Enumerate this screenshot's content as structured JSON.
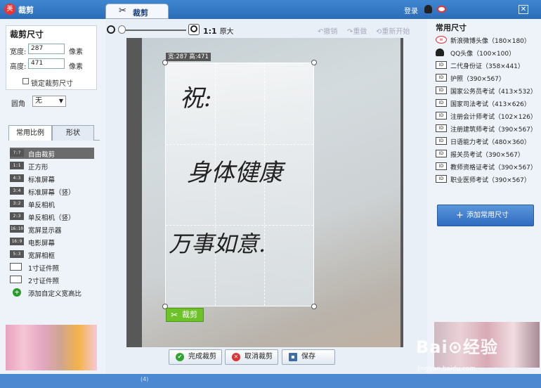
{
  "app": {
    "icon": "美",
    "title": "裁剪",
    "tab": "裁剪",
    "login": "登录",
    "close": "✕",
    "statusbar": "(4)"
  },
  "size_panel": {
    "title": "裁剪尺寸",
    "width_label": "宽度:",
    "width_value": "287",
    "height_label": "高度:",
    "height_value": "471",
    "unit": "像素",
    "lock_label": "锁定裁剪尺寸",
    "corner_label": "圆角",
    "corner_value": "无"
  },
  "ratio_tabs": [
    "常用比例",
    "形状"
  ],
  "ratios": [
    {
      "badge": "?:?",
      "label": "自由裁剪"
    },
    {
      "badge": "1:1",
      "label": "正方形"
    },
    {
      "badge": "4:3",
      "label": "标准屏幕"
    },
    {
      "badge": "3:4",
      "label": "标准屏幕（竖）"
    },
    {
      "badge": "3:2",
      "label": "单反相机"
    },
    {
      "badge": "2:3",
      "label": "单反相机（竖）"
    },
    {
      "badge": "16:10",
      "label": "宽屏显示器"
    },
    {
      "badge": "16:9",
      "label": "电影屏幕"
    },
    {
      "badge": "5:3",
      "label": "宽屏相框"
    },
    {
      "badge": "ID",
      "label": "1寸证件照"
    },
    {
      "badge": "ID",
      "label": "2寸证件照"
    },
    {
      "badge": "+",
      "label": "添加自定义宽高比"
    }
  ],
  "toolbar": {
    "zoom_ratio": "1:1",
    "zoom_orig": "原大",
    "undo": "撤销",
    "redo": "重做",
    "restart": "重新开始"
  },
  "crop": {
    "dims": "宽:287 高:471",
    "button": "裁剪",
    "hw1": "祝:",
    "hw2": "身体健康",
    "hw3": "万事如意."
  },
  "actions": {
    "done": "完成裁剪",
    "cancel": "取消裁剪",
    "save": "保存"
  },
  "sizes_panel": {
    "title": "常用尺寸",
    "add": "添加常用尺寸",
    "items": [
      "新浪微博头像（180×180）",
      "QQ头像（100×100）",
      "二代身份证（358×441）",
      "护照（390×567）",
      "国家公务员考试（413×532）",
      "国家司法考试（413×626）",
      "注册会计师考试（102×126）",
      "注册建筑师考试（390×567）",
      "日语能力考试（480×360）",
      "报关员考试（390×567）",
      "教师资格证考试（390×567）",
      "职业医师考试（390×567）"
    ]
  },
  "watermark": {
    "brand": "Bai⊙经验",
    "url": "jingyan.baidu.com"
  }
}
